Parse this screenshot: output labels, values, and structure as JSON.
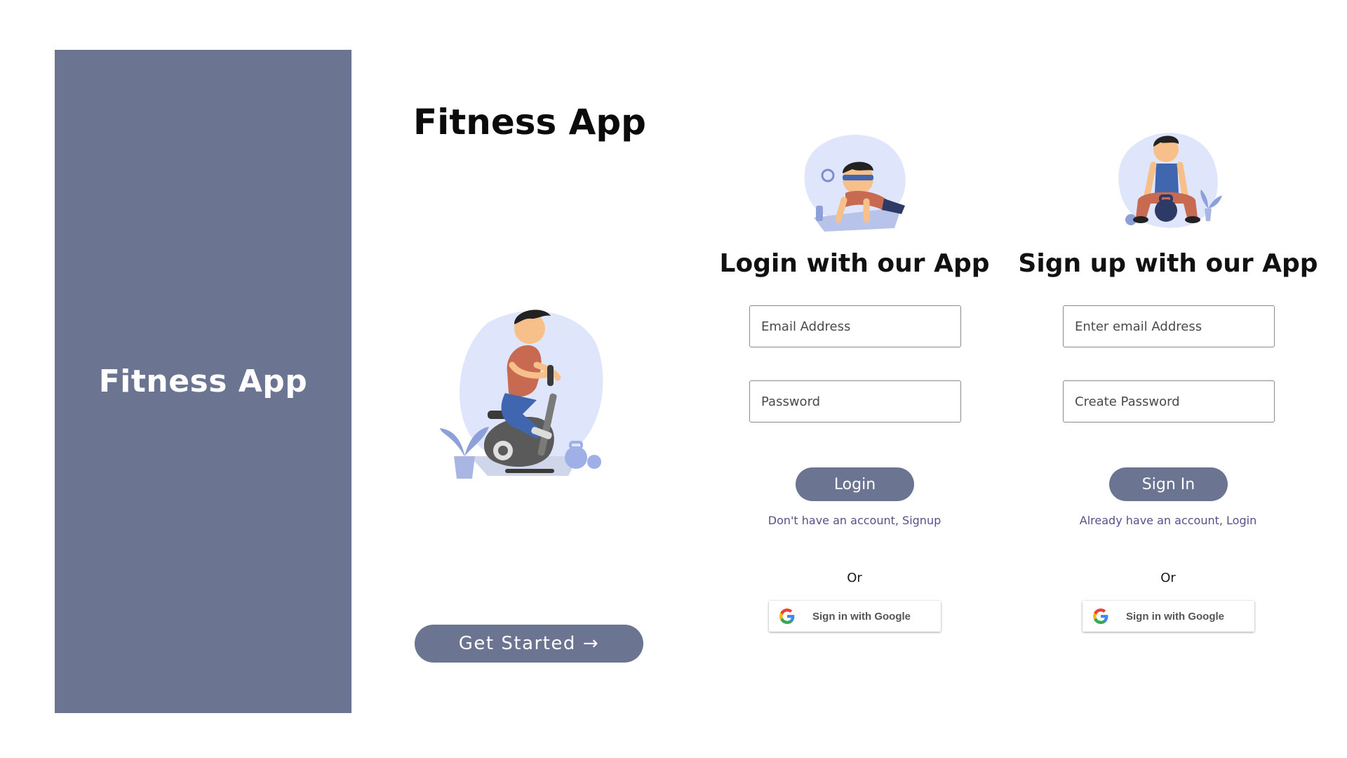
{
  "splash": {
    "title": "Fitness App"
  },
  "landing": {
    "title": "Fitness App",
    "get_started_label": "Get Started",
    "arrow_glyph": "→",
    "illustration_icon": "stationary-bike-illustration"
  },
  "login": {
    "title": "Login with our App",
    "email_placeholder": "Email Address",
    "password_placeholder": "Password",
    "button_label": "Login",
    "switch_text": "Don't have an account, Signup",
    "or_text": "Or",
    "google_label": "Sign in with Google",
    "illustration_icon": "pushup-illustration"
  },
  "signup": {
    "title": "Sign up with our App",
    "email_placeholder": "Enter email Address",
    "password_placeholder": "Create Password",
    "button_label": "Sign In",
    "switch_text": "Already have an account, Login",
    "or_text": "Or",
    "google_label": "Sign in with Google",
    "illustration_icon": "kettlebell-squat-illustration"
  },
  "colors": {
    "accent": "#6b7592",
    "link": "#5a4e8c",
    "illustration_blob": "#dfe6fb",
    "shirt": "#c86a52",
    "pants": "#4066b0"
  }
}
